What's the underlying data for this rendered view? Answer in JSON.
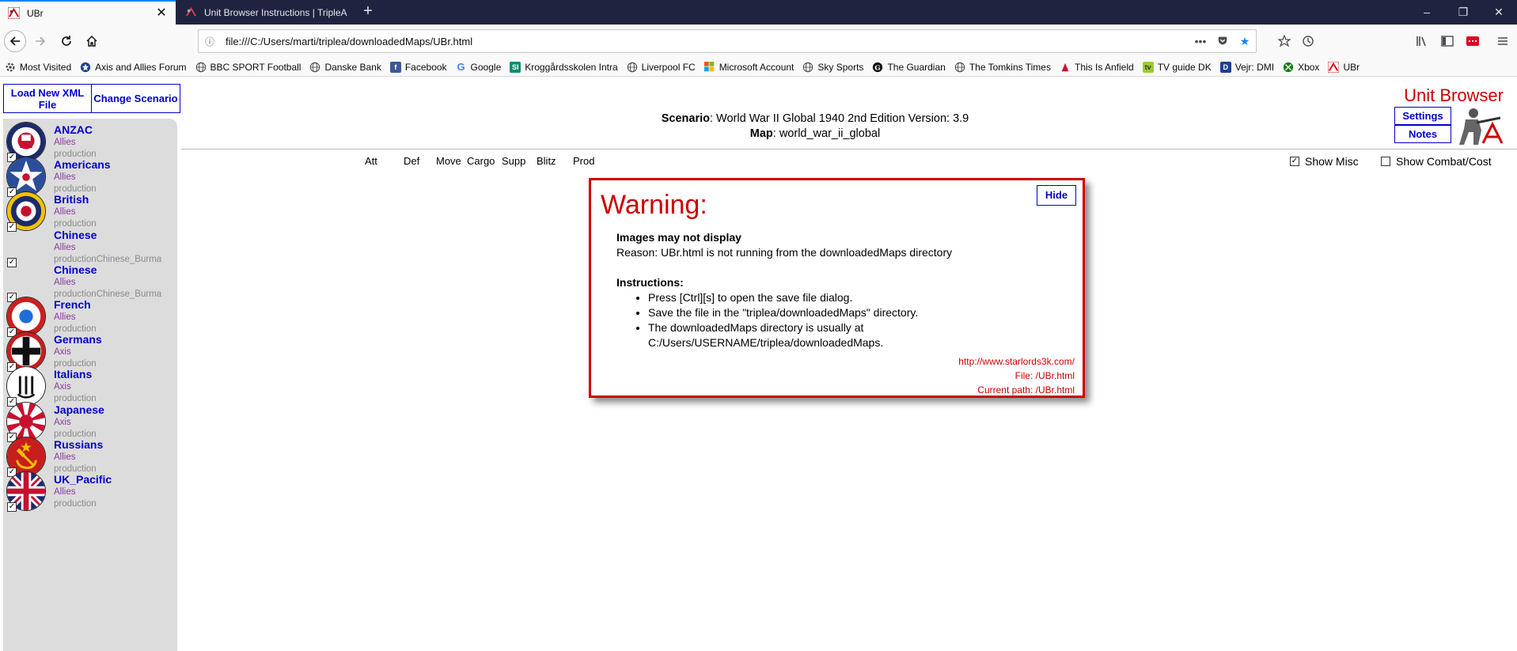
{
  "browser": {
    "tabs": [
      {
        "title": "UBr",
        "active": true
      },
      {
        "title": "Unit Browser Instructions | TripleA",
        "active": false
      }
    ],
    "url": "file:///C:/Users/marti/triplea/downloadedMaps/UBr.html",
    "window_controls": {
      "minimize": "–",
      "restore": "❐",
      "close": "✕"
    },
    "bookmarks": [
      {
        "label": "Most Visited",
        "icon": "gear-icon"
      },
      {
        "label": "Axis and Allies Forum",
        "icon": "star-icon"
      },
      {
        "label": "BBC SPORT  Football",
        "icon": "globe-icon"
      },
      {
        "label": "Danske Bank",
        "icon": "globe-icon"
      },
      {
        "label": "Facebook",
        "icon": "facebook-icon"
      },
      {
        "label": "Google",
        "icon": "google-icon"
      },
      {
        "label": "Kroggårdsskolen Intra",
        "icon": "si-icon"
      },
      {
        "label": "Liverpool FC",
        "icon": "globe-icon"
      },
      {
        "label": "Microsoft Account",
        "icon": "microsoft-icon"
      },
      {
        "label": "Sky Sports",
        "icon": "globe-icon"
      },
      {
        "label": "The Guardian",
        "icon": "guardian-icon"
      },
      {
        "label": "The Tomkins Times",
        "icon": "globe-icon"
      },
      {
        "label": "This Is Anfield",
        "icon": "liverbird-icon"
      },
      {
        "label": "TV guide DK",
        "icon": "tv-icon"
      },
      {
        "label": "Vejr: DMI",
        "icon": "dmi-icon"
      },
      {
        "label": "Xbox",
        "icon": "xbox-icon"
      },
      {
        "label": "UBr",
        "icon": "triplea-icon"
      }
    ]
  },
  "app": {
    "load_button": "Load New XML File",
    "change_button": "Change Scenario",
    "title": "Unit Browser",
    "settings_button": "Settings",
    "notes_button": "Notes",
    "scenario_label": "Scenario",
    "scenario_value": ": World War II Global 1940 2nd Edition Version: 3.9",
    "map_label": "Map",
    "map_value": ": world_war_ii_global",
    "columns": [
      "Att",
      "Def",
      "Move",
      "Cargo",
      "Supp",
      "Blitz",
      "Prod"
    ],
    "show_misc": "Show Misc",
    "show_combat": "Show Combat/Cost",
    "nations": [
      {
        "name": "ANZAC",
        "alliance": "Allies",
        "production": "production"
      },
      {
        "name": "Americans",
        "alliance": "Allies",
        "production": "production"
      },
      {
        "name": "British",
        "alliance": "Allies",
        "production": "production"
      },
      {
        "name": "Chinese",
        "alliance": "Allies",
        "production": "productionChinese_Burma"
      },
      {
        "name": "Chinese",
        "alliance": "Allies",
        "production": "productionChinese_Burma"
      },
      {
        "name": "French",
        "alliance": "Allies",
        "production": "production"
      },
      {
        "name": "Germans",
        "alliance": "Axis",
        "production": "production"
      },
      {
        "name": "Italians",
        "alliance": "Axis",
        "production": "production"
      },
      {
        "name": "Japanese",
        "alliance": "Axis",
        "production": "production"
      },
      {
        "name": "Russians",
        "alliance": "Allies",
        "production": "production"
      },
      {
        "name": "UK_Pacific",
        "alliance": "Allies",
        "production": "production"
      }
    ]
  },
  "warning": {
    "heading": "Warning:",
    "hide_button": "Hide",
    "line1": "Images may not display",
    "line2": "Reason: UBr.html is not running from the downloadedMaps directory",
    "instructions_label": "Instructions:",
    "steps": [
      "Press [Ctrl][s] to open the save file dialog.",
      "Save the file in the \"triplea/downloadedMaps\" directory.",
      "The downloadedMaps directory is usually at C:/Users/USERNAME/triplea/downloadedMaps."
    ],
    "link": "http://www.starlords3k.com/",
    "file": "File: /UBr.html",
    "path": "Current path: /UBr.html"
  }
}
